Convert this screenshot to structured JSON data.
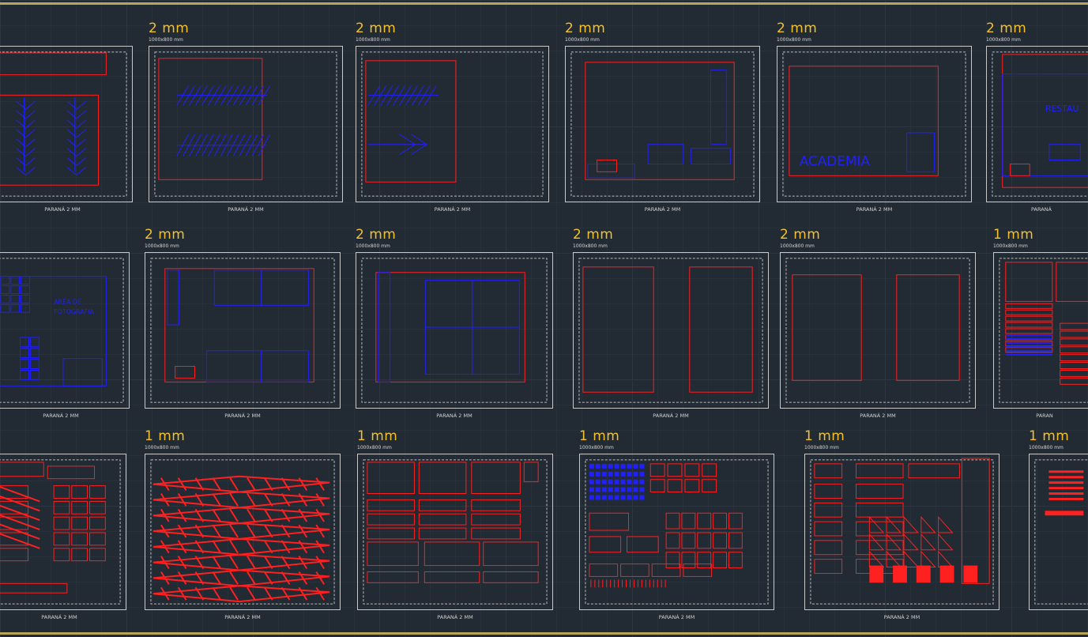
{
  "colors": {
    "background": "#222a33",
    "frame": "#c8c8c8",
    "scale_text": "#f2c12e",
    "part_outline": "#ff2020",
    "engrave": "#2020ff"
  },
  "sheets": [
    {
      "scale": "",
      "dims": "",
      "caption": "PARANÁ 2 MM"
    },
    {
      "scale": "2 mm",
      "dims": "1000x800 mm",
      "caption": "PARANÁ 2 MM"
    },
    {
      "scale": "2 mm",
      "dims": "1000x800 mm",
      "caption": "PARANÁ 2 MM"
    },
    {
      "scale": "2 mm",
      "dims": "1000x800 mm",
      "caption": "PARANÁ 2 MM"
    },
    {
      "scale": "2 mm",
      "dims": "1000x800 mm",
      "caption": "PARANÁ 2 MM",
      "label": "ACADEMIA"
    },
    {
      "scale": "2 mm",
      "dims": "1000x800 mm",
      "caption": "PARANÁ",
      "label": "RESTAU"
    },
    {
      "scale": "",
      "dims": "",
      "caption": "PARANÁ 2 MM",
      "label": "ÁREA DE FOTOGRAFIA"
    },
    {
      "scale": "2 mm",
      "dims": "1000x800 mm",
      "caption": "PARANÁ 2 MM"
    },
    {
      "scale": "2 mm",
      "dims": "1000x800 mm",
      "caption": "PARANÁ 2 MM"
    },
    {
      "scale": "2 mm",
      "dims": "1000x800 mm",
      "caption": "PARANÁ 2 MM"
    },
    {
      "scale": "2 mm",
      "dims": "1000x800 mm",
      "caption": "PARANÁ 2 MM"
    },
    {
      "scale": "1 mm",
      "dims": "1000x800 mm",
      "caption": "PARAN"
    },
    {
      "scale": "",
      "dims": "",
      "caption": "PARANÁ 2 MM"
    },
    {
      "scale": "1 mm",
      "dims": "1000x800 mm",
      "caption": "PARANÁ 2 MM"
    },
    {
      "scale": "1 mm",
      "dims": "1000x800 mm",
      "caption": "PARANÁ 2 MM"
    },
    {
      "scale": "1 mm",
      "dims": "1000x800 mm",
      "caption": "PARANÁ 2 MM"
    },
    {
      "scale": "1 mm",
      "dims": "1000x800 mm",
      "caption": "PARANÁ 2 MM"
    },
    {
      "scale": "1 mm",
      "dims": "1000x800 mm",
      "caption": ""
    }
  ]
}
